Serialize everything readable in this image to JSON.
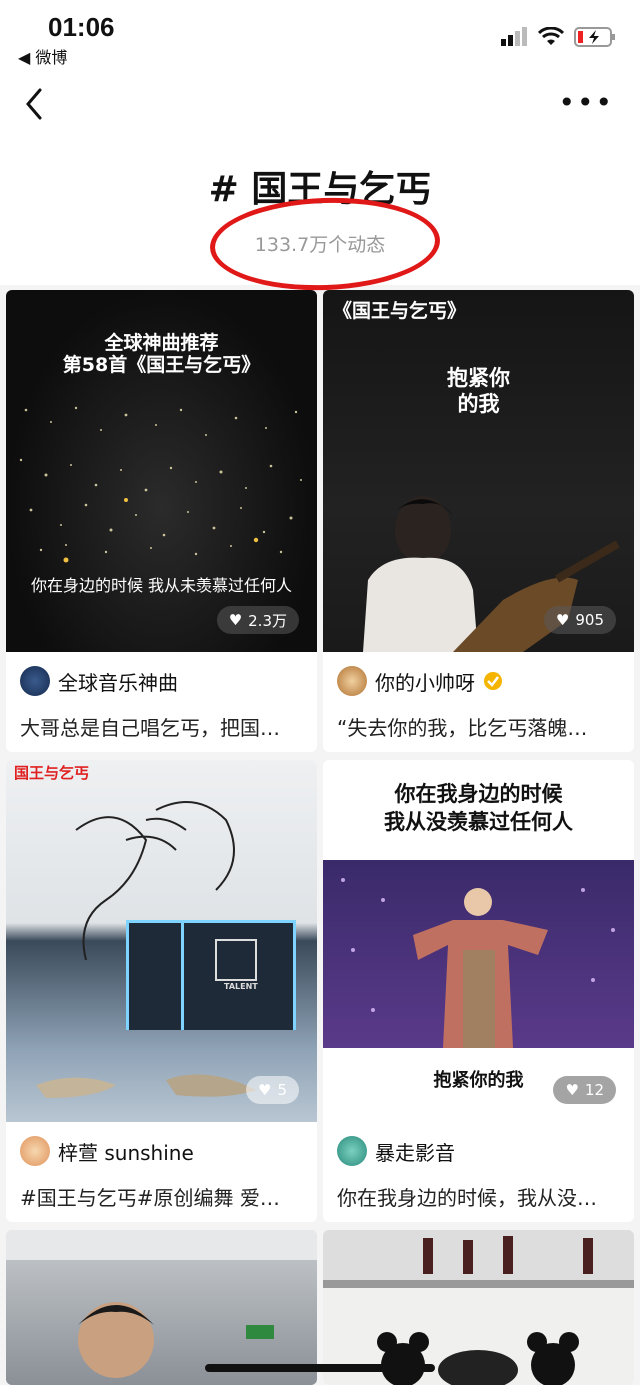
{
  "status": {
    "time": "01:06",
    "back_app": "◀ 微博"
  },
  "header": {
    "title": "# 国王与乞丐",
    "count": "133.7万个动态",
    "more": "•••"
  },
  "cards": [
    {
      "overlay_1": "全球神曲推荐",
      "overlay_2": "第58首《国王与乞丐》",
      "caption": "你在身边的时候 我从未羡慕过任何人",
      "likes": "2.3万",
      "author": "全球音乐神曲",
      "desc": "大哥总是自己唱乞丐，把国…"
    },
    {
      "overlay_1": "《国王与乞丐》",
      "overlay_2": "抱紧你",
      "overlay_3": "的我",
      "likes": "905",
      "author": "你的小帅呀",
      "desc": "“失去你的我，比乞丐落魄…"
    },
    {
      "overlay_1": "国王与乞丐",
      "likes": "5",
      "author": "梓萱 sunshine",
      "desc": "#国王与乞丐#原创编舞 爱…",
      "sign": "TALENT"
    },
    {
      "overlay_1": "你在我身边的时候",
      "overlay_2": "我从没羡慕过任何人",
      "caption": "抱紧你的我",
      "likes": "12",
      "author": "暴走影音",
      "desc": "你在我身边的时候，我从没…"
    }
  ]
}
